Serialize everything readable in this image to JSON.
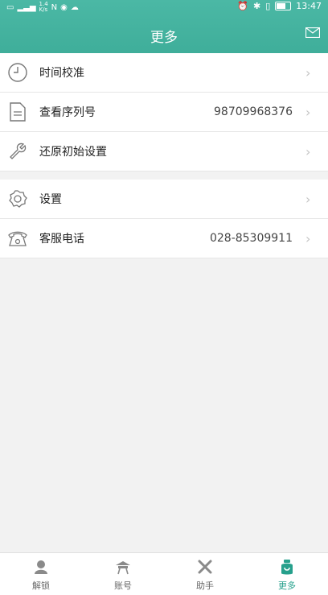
{
  "status": {
    "speed": "1.4\nK/s",
    "time": "13:47"
  },
  "header": {
    "title": "更多"
  },
  "list": [
    {
      "label": "时间校准",
      "value": ""
    },
    {
      "label": "查看序列号",
      "value": "98709968376"
    },
    {
      "label": "还原初始设置",
      "value": ""
    },
    {
      "label": "设置",
      "value": ""
    },
    {
      "label": "客服电话",
      "value": "028-85309911"
    }
  ],
  "tabs": [
    {
      "label": "解锁"
    },
    {
      "label": "账号"
    },
    {
      "label": "助手"
    },
    {
      "label": "更多"
    }
  ],
  "colors": {
    "accent": "#3fae9a",
    "active_tab": "#26a08c"
  }
}
